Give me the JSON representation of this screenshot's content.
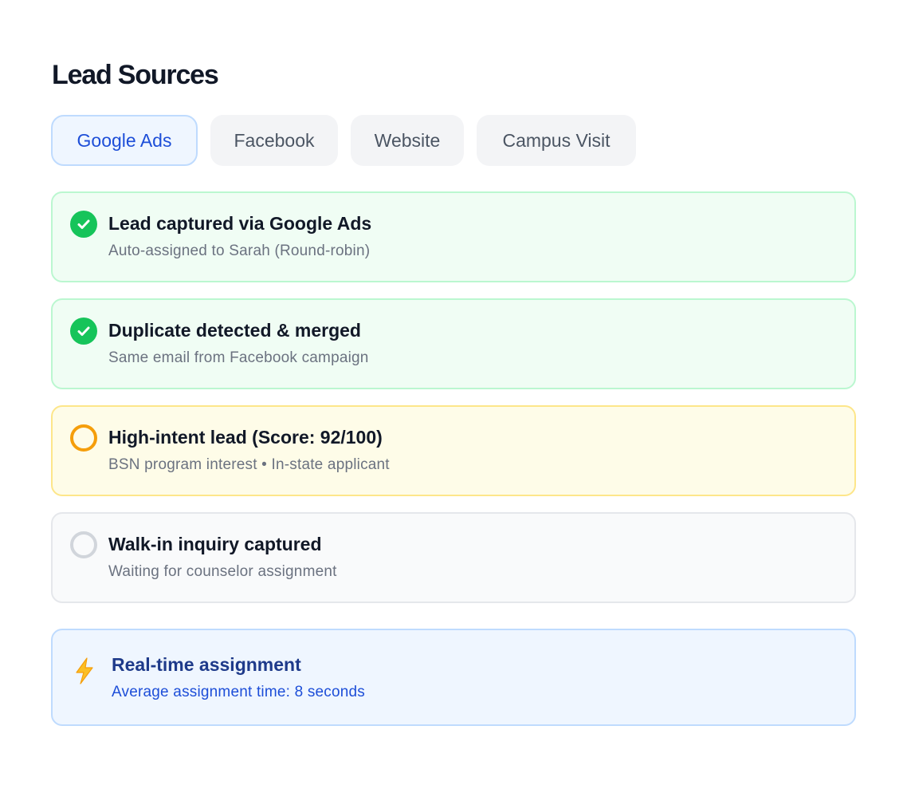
{
  "header": {
    "title": "Lead Sources"
  },
  "tabs": [
    {
      "label": "Google Ads",
      "active": true
    },
    {
      "label": "Facebook",
      "active": false
    },
    {
      "label": "Website",
      "active": false
    },
    {
      "label": "Campus Visit",
      "active": false
    }
  ],
  "events": [
    {
      "status": "done",
      "icon": "check-circle-icon",
      "title": "Lead captured via Google Ads",
      "subtitle": "Auto-assigned to Sarah (Round-robin)"
    },
    {
      "status": "done",
      "icon": "check-circle-icon",
      "title": "Duplicate detected & merged",
      "subtitle": "Same email from Facebook campaign"
    },
    {
      "status": "pending",
      "icon": "ring-amber-icon",
      "title": "High-intent lead (Score: 92/100)",
      "subtitle": "BSN program interest • In-state applicant"
    },
    {
      "status": "waiting",
      "icon": "ring-gray-icon",
      "title": "Walk-in inquiry captured",
      "subtitle": "Waiting for counselor assignment"
    }
  ],
  "info": {
    "icon": "lightning-bolt-icon",
    "title": "Real-time assignment",
    "subtitle": "Average assignment time: 8 seconds"
  },
  "colors": {
    "accent": "#1d4ed8",
    "success": "#16c45a",
    "warning": "#f59e0b",
    "muted": "#d1d5db"
  }
}
